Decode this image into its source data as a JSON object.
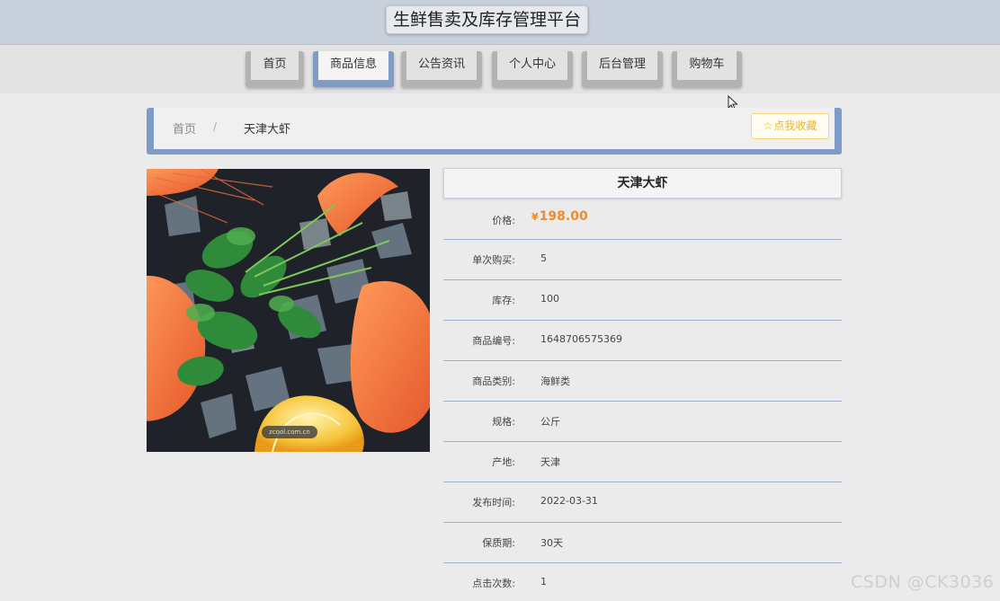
{
  "header": {
    "title": "生鲜售卖及库存管理平台"
  },
  "nav": {
    "items": [
      {
        "label": "首页",
        "active": false
      },
      {
        "label": "商品信息",
        "active": true
      },
      {
        "label": "公告资讯",
        "active": false
      },
      {
        "label": "个人中心",
        "active": false
      },
      {
        "label": "后台管理",
        "active": false
      },
      {
        "label": "购物车",
        "active": false
      }
    ]
  },
  "breadcrumb": {
    "home": "首页",
    "separator": "/",
    "current": "天津大虾"
  },
  "favorite": {
    "icon": "star-outline-icon",
    "label": "点我收藏"
  },
  "product": {
    "title": "天津大虾",
    "image_watermark": "zcool.com.cn",
    "price_label": "价格:",
    "currency": "¥",
    "price": "198.00",
    "fields": [
      {
        "label": "单次购买:",
        "value": "5"
      },
      {
        "label": "库存:",
        "value": "100"
      },
      {
        "label": "商品编号:",
        "value": "1648706575369"
      },
      {
        "label": "商品类别:",
        "value": "海鲜类"
      },
      {
        "label": "规格:",
        "value": "公斤"
      },
      {
        "label": "产地:",
        "value": "天津"
      },
      {
        "label": "发布时间:",
        "value": "2022-03-31"
      },
      {
        "label": "保质期:",
        "value": "30天"
      },
      {
        "label": "点击次数:",
        "value": "1"
      }
    ]
  },
  "watermark": "CSDN @CK3036",
  "colors": {
    "accent": "#7e9cc6",
    "price": "#f08a2c",
    "favorite": "#e9b52e",
    "header_bg": "#c8d0dc"
  }
}
